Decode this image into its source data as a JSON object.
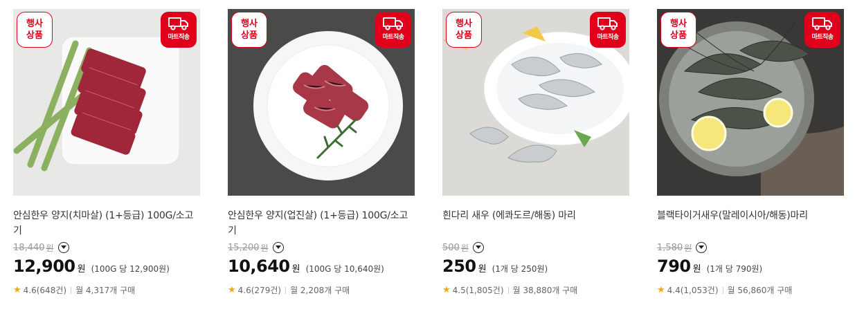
{
  "products": [
    {
      "event_badge": [
        "행사",
        "상품"
      ],
      "delivery_badge": "마트직송",
      "delivery_icon": "truck-icon",
      "name": "안심한우 양지(치마살) (1+등급) 100G/소고기",
      "original_price": "18,440",
      "original_unit": "원",
      "price": "12,900",
      "price_unit": "원",
      "unit_price": "(100G 당 12,900원)",
      "rating": "4.6(648건)",
      "monthly": "월 4,317개 구매"
    },
    {
      "event_badge": [
        "행사",
        "상품"
      ],
      "delivery_badge": "마트직송",
      "delivery_icon": "truck-icon",
      "name": "안심한우 양지(업진살) (1+등급) 100G/소고기",
      "original_price": "15,200",
      "original_unit": "원",
      "price": "10,640",
      "price_unit": "원",
      "unit_price": "(100G 당 10,640원)",
      "rating": "4.6(279건)",
      "monthly": "월 2,208개 구매"
    },
    {
      "event_badge": [
        "행사",
        "상품"
      ],
      "delivery_badge": "마트직송",
      "delivery_icon": "truck-icon",
      "name": "흰다리 새우 (에콰도르/해동) 마리",
      "original_price": "500",
      "original_unit": "원",
      "price": "250",
      "price_unit": "원",
      "unit_price": "(1개 당 250원)",
      "rating": "4.5(1,805건)",
      "monthly": "월 38,880개 구매"
    },
    {
      "event_badge": [
        "행사",
        "상품"
      ],
      "delivery_badge": "마트직송",
      "delivery_icon": "truck-icon",
      "name": "블랙타이거새우(말레이시아/해동)마리",
      "original_price": "1,580",
      "original_unit": "원",
      "price": "790",
      "price_unit": "원",
      "unit_price": "(1개 당 790원)",
      "rating": "4.4(1,053건)",
      "monthly": "월 56,860개 구매"
    }
  ],
  "colors": {
    "accent": "#e0001b",
    "star": "#f5a800",
    "muted": "#999999"
  }
}
